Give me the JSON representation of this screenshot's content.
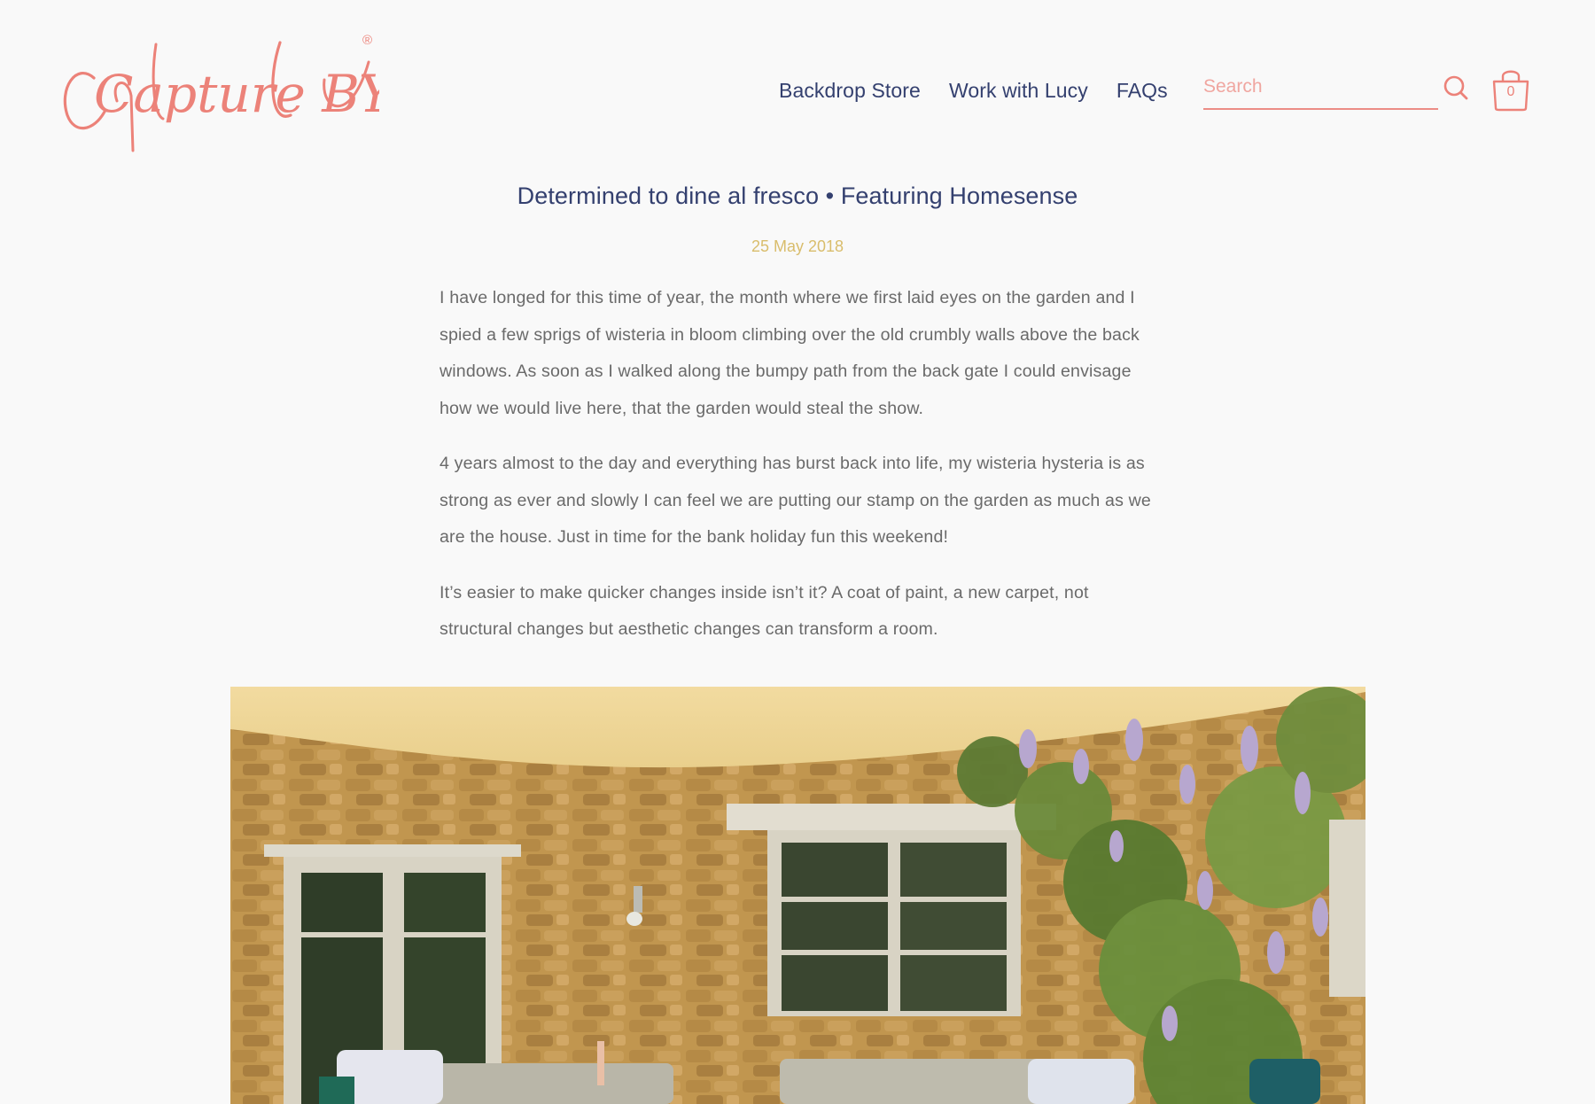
{
  "header": {
    "logo": {
      "text": "Capture BY Lucy",
      "registered_mark": "®",
      "icon": "capture-by-lucy-script-logo"
    },
    "nav": [
      {
        "label": "Backdrop Store"
      },
      {
        "label": "Work with Lucy"
      },
      {
        "label": "FAQs"
      }
    ],
    "search": {
      "placeholder": "Search",
      "value": "",
      "icon": "search-icon"
    },
    "cart": {
      "icon": "shopping-bag-icon",
      "count": "0"
    }
  },
  "article": {
    "title": "Determined to dine al fresco • Featuring Homesense",
    "date": "25 May 2018",
    "paragraphs": [
      "I have longed for this time of year, the month where we first laid eyes on the garden and I spied a few sprigs of wisteria in bloom climbing over the old crumbly walls above the back windows. As soon as I walked along the bumpy path from the back gate I could envisage how we would live here, that the garden would steal the show.",
      "4 years almost to the day and everything has burst back into life, my wisteria hysteria is as strong as ever and slowly I can feel we are putting our stamp on the garden as much as we are the house. Just in time for the bank holiday fun this weekend!",
      "It’s easier to make quicker changes inside isn’t it? A coat of paint, a new carpet, not structural changes but aesthetic changes can transform a room."
    ],
    "hero_image": {
      "icon": "garden-patio-photo"
    }
  },
  "colors": {
    "background": "#f9f9f9",
    "brand_coral": "#ec8279",
    "nav_navy": "#34406f",
    "date_gold": "#d9bd6c",
    "body_gray": "#6a6a6a"
  }
}
